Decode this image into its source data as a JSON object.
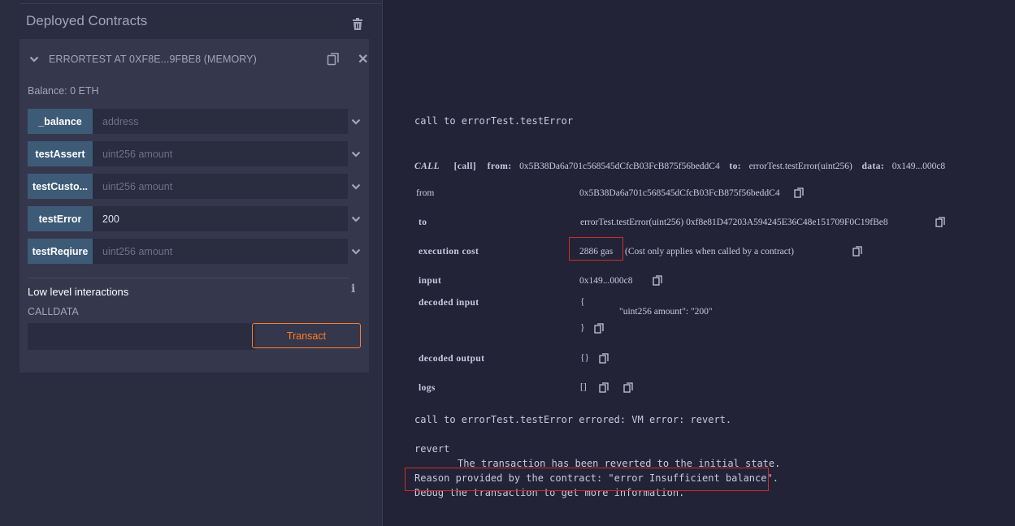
{
  "left_panel": {
    "title": "Deployed Contracts",
    "contract": {
      "name": "ERRORTEST AT 0XF8E...9FBE8 (MEMORY)",
      "balance": "Balance: 0 ETH",
      "functions": [
        {
          "label": "_balance",
          "value": "",
          "placeholder": "address"
        },
        {
          "label": "testAssert",
          "value": "",
          "placeholder": "uint256 amount"
        },
        {
          "label": "testCusto...",
          "value": "",
          "placeholder": "uint256 amount"
        },
        {
          "label": "testError",
          "value": "200",
          "placeholder": "uint256 amount"
        },
        {
          "label": "testReqiure",
          "value": "",
          "placeholder": "uint256 amount"
        }
      ]
    },
    "low_level": {
      "title": "Low level interactions",
      "calldata_label": "CALLDATA",
      "transact_label": "Transact"
    }
  },
  "terminal": {
    "call_line": "call to errorTest.testError",
    "call_tag": "CALL",
    "call_kind": "[call]",
    "from_key": "from:",
    "from_addr": "0x5B38Da6a701c568545dCfcB03FcB875f56beddC4",
    "to_key": "to:",
    "to_fn": "errorTest.testError(uint256)",
    "data_key": "data:",
    "data_val": "0x149...000c8",
    "rows": {
      "from_label": "from",
      "from_value": "0x5B38Da6a701c568545dCfcB03FcB875f56beddC4",
      "to_label": "to",
      "to_value": "errorTest.testError(uint256) 0xf8e81D47203A594245E36C48e151709F0C19fBe8",
      "exec_label": "execution cost",
      "exec_gas": "2886 gas",
      "exec_note": "(Cost only applies when called by a contract)",
      "input_label": "input",
      "input_value": "0x149...000c8",
      "decoded_input_label": "decoded input",
      "decoded_input_open": "{",
      "decoded_input_body": "\"uint256 amount\": \"200\"",
      "decoded_input_close": "}",
      "decoded_output_label": "decoded output",
      "decoded_output_value": "{}",
      "logs_label": "logs",
      "logs_value": "[]"
    },
    "error_line": "call to errorTest.testError errored: VM error: revert.",
    "revert": "revert",
    "revert_msg": "The transaction has been reverted to the initial state.",
    "reason": "Reason provided by the contract: \"error Insufficient balance\".",
    "debug": "Debug the transaction to get more information."
  },
  "colors": {
    "panel_bg": "#2a2c3f",
    "card_bg": "#35384c",
    "fn_button": "#3d5b77",
    "transact_accent": "#ff7c28",
    "highlight_box": "#d22b2b"
  },
  "icons": [
    "trash-icon",
    "chevron-down-icon",
    "copy-icon",
    "close-icon",
    "info-icon"
  ]
}
